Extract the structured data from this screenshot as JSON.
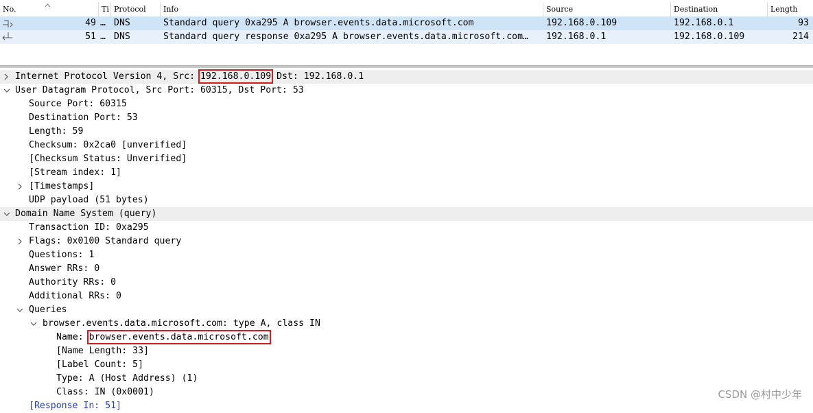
{
  "packet_list": {
    "columns": [
      "No.",
      "Ti",
      "Protocol",
      "Info",
      "Source",
      "Destination",
      "Length"
    ],
    "rows": [
      {
        "no": "49",
        "time": "…",
        "protocol": "DNS",
        "info": "Standard query 0xa295 A browser.events.data.microsoft.com",
        "source": "192.168.0.109",
        "destination": "192.168.0.1",
        "length": "93"
      },
      {
        "no": "51",
        "time": "…",
        "protocol": "DNS",
        "info": "Standard query response 0xa295 A browser.events.data.microsoft.com…",
        "source": "192.168.0.1",
        "destination": "192.168.0.109",
        "length": "214"
      }
    ]
  },
  "details": {
    "ip": {
      "prefix": "Internet Protocol Version 4, Src: ",
      "src": "192.168.0.109",
      "suffix": " Dst: 192.168.0.1"
    },
    "udp": {
      "title": "User Datagram Protocol, Src Port: 60315, Dst Port: 53",
      "source_port": "Source Port: 60315",
      "destination_port": "Destination Port: 53",
      "length": "Length: 59",
      "checksum": "Checksum: 0x2ca0 [unverified]",
      "checksum_status": "[Checksum Status: Unverified]",
      "stream_index": "[Stream index: 1]",
      "timestamps": "[Timestamps]",
      "payload": "UDP payload (51 bytes)"
    },
    "dns": {
      "title": "Domain Name System (query)",
      "transaction_id": "Transaction ID: 0xa295",
      "flags": "Flags: 0x0100 Standard query",
      "questions": "Questions: 1",
      "answer_rrs": "Answer RRs: 0",
      "authority_rrs": "Authority RRs: 0",
      "additional_rrs": "Additional RRs: 0",
      "queries": "Queries",
      "query_entry": "browser.events.data.microsoft.com: type A, class IN",
      "name_label": "Name: ",
      "name_value": "browser.events.data.microsoft.com",
      "name_length": "[Name Length: 33]",
      "label_count": "[Label Count: 5]",
      "type": "Type: A (Host Address) (1)",
      "class": "Class: IN (0x0001)",
      "response_in": "[Response In: 51]"
    }
  },
  "watermark": "CSDN @村中少年",
  "colors": {
    "selected_row": "#d0e4f7",
    "related_row": "#e8f1fb",
    "highlight_box": "#cc1f1f"
  }
}
